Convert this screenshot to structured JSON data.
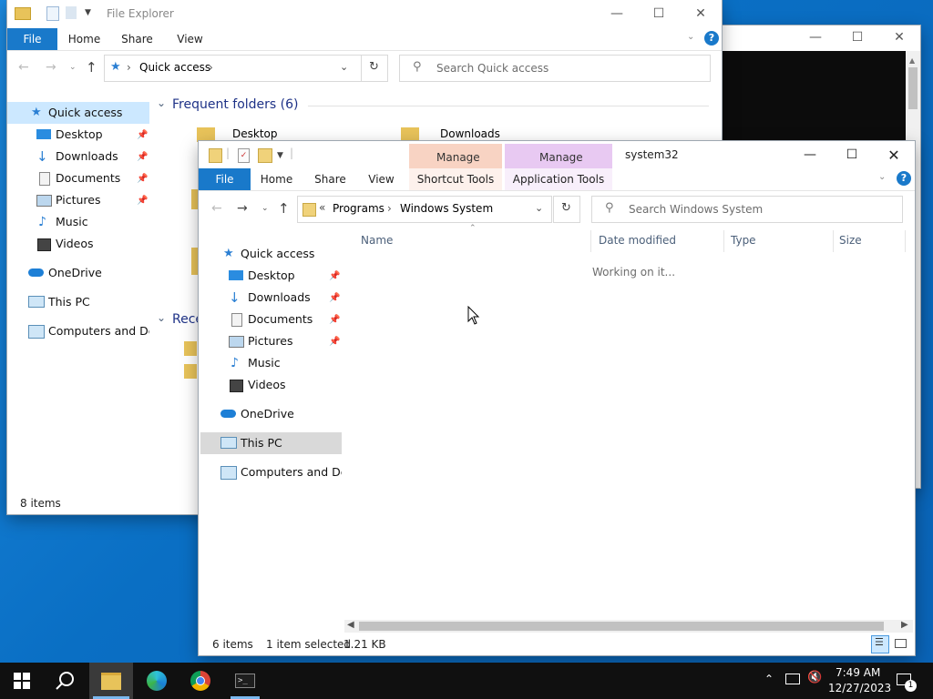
{
  "back_window": {
    "title": "File Explorer",
    "ribbon_tabs": [
      "File",
      "Home",
      "Share",
      "View"
    ],
    "address_text": "Quick access",
    "search_placeholder": "Search Quick access",
    "group_frequent": "Frequent folders (6)",
    "group_recent": "Rece",
    "folder_desktop": "Desktop",
    "folder_downloads": "Downloads",
    "nav": [
      {
        "label": "Quick access"
      },
      {
        "label": "Desktop"
      },
      {
        "label": "Downloads"
      },
      {
        "label": "Documents"
      },
      {
        "label": "Pictures"
      },
      {
        "label": "Music"
      },
      {
        "label": "Videos"
      },
      {
        "label": "OneDrive"
      },
      {
        "label": "This PC"
      },
      {
        "label": "Computers and Devic"
      }
    ],
    "status": "8 items"
  },
  "front_window": {
    "title": "system32",
    "context_manage_1": "Manage",
    "context_manage_2": "Manage",
    "ribbon_tabs": [
      "File",
      "Home",
      "Share",
      "View",
      "Shortcut Tools",
      "Application Tools"
    ],
    "breadcrumb_overflow": "«",
    "breadcrumb": [
      "Programs",
      "Windows System"
    ],
    "search_placeholder": "Search Windows System",
    "columns": [
      "Name",
      "Date modified",
      "Type",
      "Size"
    ],
    "working_text": "Working on it...",
    "nav": [
      {
        "label": "Quick access"
      },
      {
        "label": "Desktop"
      },
      {
        "label": "Downloads"
      },
      {
        "label": "Documents"
      },
      {
        "label": "Pictures"
      },
      {
        "label": "Music"
      },
      {
        "label": "Videos"
      },
      {
        "label": "OneDrive"
      },
      {
        "label": "This PC"
      },
      {
        "label": "Computers and Devic"
      }
    ],
    "status_items": "6 items",
    "status_selected": "1 item selected",
    "status_size": "1.21 KB"
  },
  "taskbar": {
    "time": "7:49 AM",
    "date": "12/27/2023",
    "notification_count": "1"
  },
  "colors": {
    "accent": "#1979ca",
    "manage_shortcut": "#f8d3c3",
    "manage_app": "#e8c9f2",
    "nav_selected": "#cce8ff",
    "taskbar": "#101010"
  }
}
